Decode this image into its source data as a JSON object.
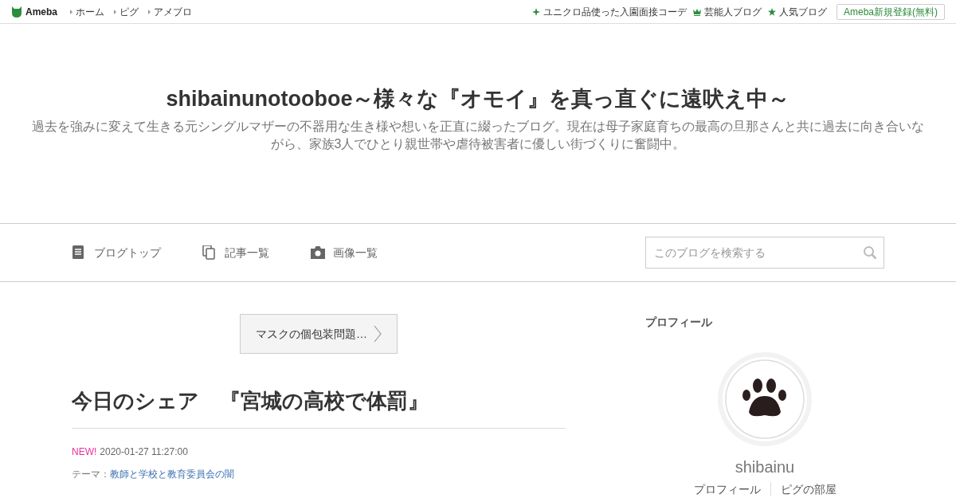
{
  "topbar": {
    "logo": "Ameba",
    "links": [
      "ホーム",
      "ピグ",
      "アメブロ"
    ],
    "right_links": [
      {
        "kind": "sparkle",
        "label": "ユニクロ品使った入園面接コーデ"
      },
      {
        "kind": "crown",
        "label": "芸能人ブログ"
      },
      {
        "kind": "star",
        "label": "人気ブログ"
      }
    ],
    "signup": "Ameba新規登録(無料)"
  },
  "blog": {
    "title": "shibainunotooboe～様々な『オモイ』を真っ直ぐに遠吠え中～",
    "description": "過去を強みに変えて生きる元シングルマザーの不器用な生き様や想いを正直に綴ったブログ。現在は母子家庭育ちの最高の旦那さんと共に過去に向き合いながら、家族3人でひとり親世帯や虐待被害者に優しい街づくりに奮闘中。"
  },
  "nav": [
    {
      "kind": "document",
      "label": "ブログトップ"
    },
    {
      "kind": "copy",
      "label": "記事一覧"
    },
    {
      "kind": "camera",
      "label": "画像一覧"
    }
  ],
  "search": {
    "placeholder": "このブログを検索する"
  },
  "article": {
    "prev_link": "マスクの個包装問題…",
    "title": "今日のシェア　『宮城の高校で体罰』",
    "new_badge": "NEW!",
    "date": "2020-01-27 11:27:00",
    "theme_label": "テーマ：",
    "theme": "教師と学校と教育委員会の闇"
  },
  "profile": {
    "heading": "プロフィール",
    "avatar": {
      "kind": "picture"
    },
    "name": "shibainu",
    "links": [
      "プロフィール",
      "ピグの部屋"
    ]
  }
}
